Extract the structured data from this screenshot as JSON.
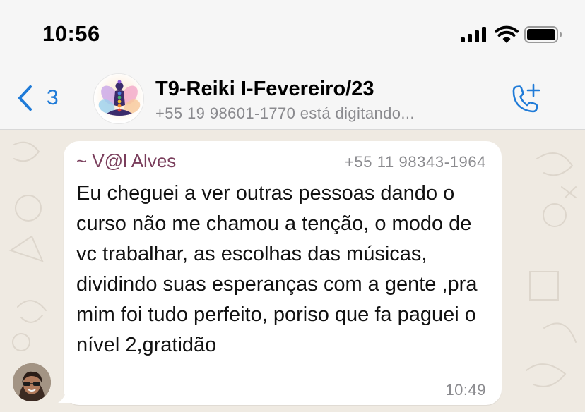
{
  "status_bar": {
    "time": "10:56",
    "icons": [
      "cellular-signal-icon",
      "wifi-icon",
      "battery-icon"
    ]
  },
  "nav": {
    "back_count": "3",
    "title": "T9-Reiki I-Fevereiro/23",
    "subtitle": "+55 19 98601-1770 está digitando...",
    "accent_color": "#1f7bd8",
    "icons": [
      "back-chevron-icon",
      "add-call-icon"
    ]
  },
  "message": {
    "sender_name": "~ V@l Alves",
    "sender_phone": "+55 11 98343-1964",
    "text": "Eu cheguei a ver outras pessoas dando o curso não me chamou a tenção, o modo de vc trabalhar, as escolhas das músicas, dividindo suas esperanças com a gente ,pra mim foi tudo perfeito, poriso que fa paguei o nível 2,gratidão",
    "time": "10:49",
    "sender_color": "#7a3e5c"
  },
  "colors": {
    "chat_background": "#efeae2",
    "bubble": "#ffffff",
    "header": "#f6f6f6"
  }
}
